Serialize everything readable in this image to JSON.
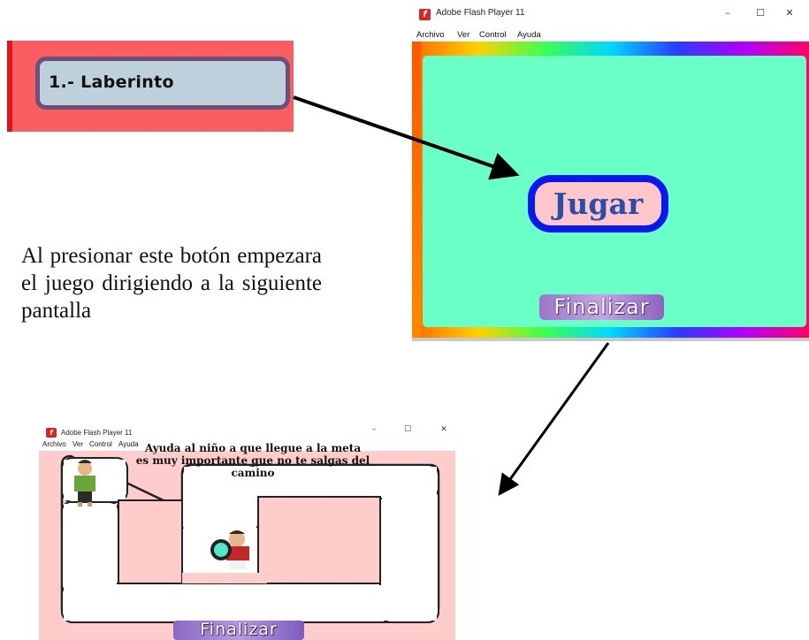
{
  "label_card": {
    "text": "1.- Laberinto"
  },
  "description": "Al presionar este botón empezara el juego dirigiendo a la siguiente pantalla",
  "window_main": {
    "title": "Adobe Flash Player 11",
    "menu": [
      "Archivo",
      "Ver",
      "Control",
      "Ayuda"
    ],
    "controls": [
      "–",
      "☐",
      "✕"
    ],
    "play_button": "Jugar",
    "finish_button": "Finalizar"
  },
  "window_game": {
    "title": "Adobe Flash Player 11",
    "menu": [
      "Archivo",
      "Ver",
      "Control",
      "Ayuda"
    ],
    "controls": [
      "–",
      "☐",
      "✕"
    ],
    "instruction_line1": "Ayuda al niño a que llegue a la meta",
    "instruction_line2": "es muy importante que no te salgas del camino",
    "finish_button": "Finalizar"
  },
  "colors": {
    "label_bg": "#fb5e62",
    "label_inner": "#bdd0db",
    "stage_green": "#6affc7",
    "play_border": "#0a18f0",
    "play_fill": "#ffc6cc",
    "play_text": "#2b4fa8",
    "maze_bg": "#ffcccc"
  },
  "icons": [
    "flash-logo-icon",
    "minimize-icon",
    "maximize-icon",
    "close-icon",
    "arrow-icon",
    "boy-character-icon",
    "magnifier-character-icon"
  ]
}
